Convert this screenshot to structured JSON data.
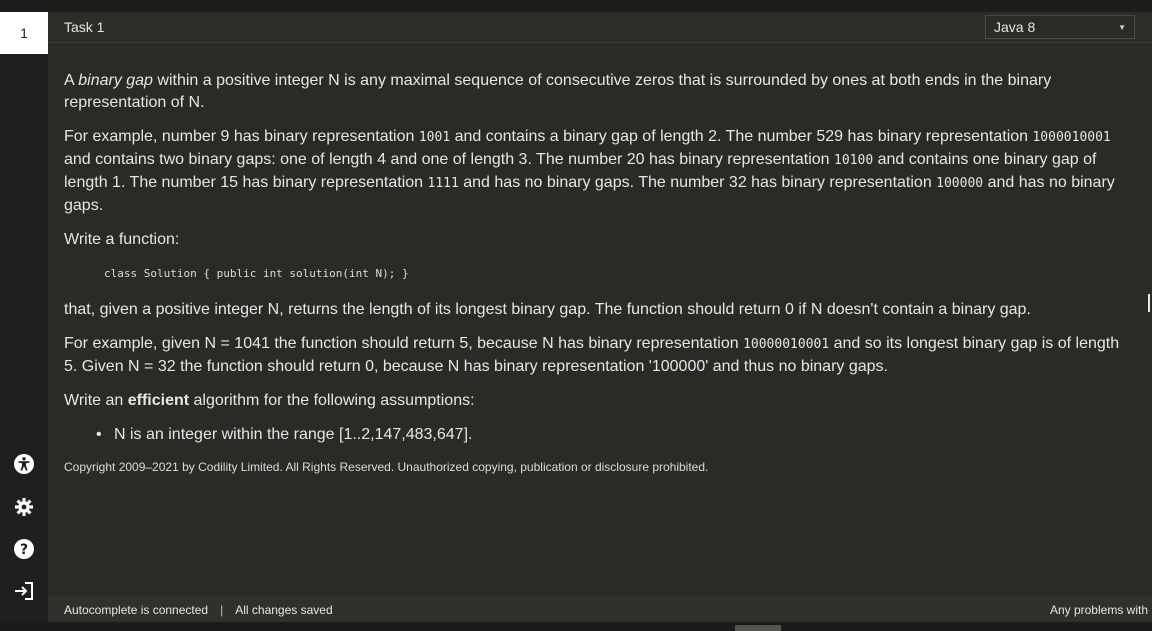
{
  "colors": {
    "background": "#2a2a27",
    "rail": "#1f1f1d",
    "task_tab": "#ffffff",
    "text": "#e6e6e6"
  },
  "rail": {
    "task_number": "1",
    "icons": [
      "accessibility-icon",
      "settings-gear-icon",
      "help-icon",
      "logout-icon"
    ]
  },
  "header": {
    "task_title": "Task 1",
    "language": "Java 8"
  },
  "content": {
    "p1_a": "A ",
    "p1_em": "binary gap",
    "p1_b": " within a positive integer N is any maximal sequence of consecutive zeros that is surrounded by ones at both ends in the binary representation of N.",
    "p2_a": "For example, number 9 has binary representation ",
    "p2_code1": "1001",
    "p2_b": " and contains a binary gap of length 2. The number 529 has binary representation ",
    "p2_code2": "1000010001",
    "p2_c": " and contains two binary gaps: one of length 4 and one of length 3. The number 20 has binary representation ",
    "p2_code3": "10100",
    "p2_d": " and contains one binary gap of length 1. The number 15 has binary representation ",
    "p2_code4": "1111",
    "p2_e": " and has no binary gaps. The number 32 has binary representation ",
    "p2_code5": "100000",
    "p2_f": " and has no binary gaps.",
    "p3": "Write a function:",
    "code_block": "class Solution { public int solution(int N); }",
    "p4": "that, given a positive integer N, returns the length of its longest binary gap. The function should return 0 if N doesn't contain a binary gap.",
    "p5_a": "For example, given N = 1041 the function should return 5, because N has binary representation ",
    "p5_code": "10000010001",
    "p5_b": " and so its longest binary gap is of length 5. Given N = 32 the function should return 0, because N has binary representation '100000' and thus no binary gaps.",
    "p6_a": "Write an ",
    "p6_strong": "efficient",
    "p6_b": " algorithm for the following assumptions:",
    "bullet1": "N is an integer within the range [1..2,147,483,647].",
    "copyright": "Copyright 2009–2021 by Codility Limited. All Rights Reserved. Unauthorized copying, publication or disclosure prohibited."
  },
  "status": {
    "autocomplete": "Autocomplete is connected",
    "separator": "|",
    "saved": "All changes saved",
    "problems": "Any problems with"
  }
}
